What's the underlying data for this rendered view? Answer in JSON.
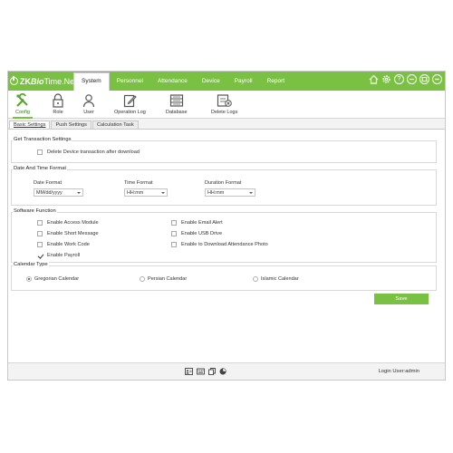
{
  "app": {
    "logo": {
      "zk": "ZK",
      "bio": "Bio",
      "rest": "Time.Net"
    },
    "nav": [
      "System",
      "Personnel",
      "Attendance",
      "Device",
      "Payroll",
      "Report"
    ],
    "active_nav": "System",
    "window_controls": [
      "home-icon",
      "gear-icon",
      "help-icon",
      "minimize-icon",
      "maximize-icon",
      "close-icon"
    ],
    "help_glyph": "?"
  },
  "toolbar": {
    "items": [
      {
        "label": "Config",
        "icon": "config-icon",
        "active": true
      },
      {
        "label": "Role",
        "icon": "lock-icon"
      },
      {
        "label": "User",
        "icon": "user-icon"
      },
      {
        "label": "Operation Log",
        "icon": "edit-log-icon"
      },
      {
        "label": "Database",
        "icon": "database-icon"
      },
      {
        "label": "Delete Logs",
        "icon": "delete-logs-icon"
      }
    ]
  },
  "subtabs": [
    "Basic Settings",
    "Push Settings",
    "Calculation Task"
  ],
  "active_subtab": "Basic Settings",
  "transaction": {
    "title": "Get Transaction Settings",
    "delete_label": "Delete Device transaction after download",
    "delete_checked": false
  },
  "datetime": {
    "title": "Date And Time Format",
    "date_label": "Date Format",
    "date_value": "MM/dd/yyyy",
    "time_label": "Time Format",
    "time_value": "HH:mm",
    "duration_label": "Duration Format",
    "duration_value": "HH:mm"
  },
  "software": {
    "title": "Software Function",
    "left": [
      {
        "label": "Enable Access Module",
        "checked": false
      },
      {
        "label": "Enable Short Message",
        "checked": false
      },
      {
        "label": "Enable Work Code",
        "checked": false
      },
      {
        "label": "Enable Payroll",
        "checked": true
      }
    ],
    "right": [
      {
        "label": "Enable Email Alert",
        "checked": false
      },
      {
        "label": "Enable USB Drive",
        "checked": false
      },
      {
        "label": "Enable to Download Attendance Photo",
        "checked": false
      }
    ]
  },
  "calendar": {
    "title": "Calendar Type",
    "options": [
      "Gregorian Calendar",
      "Persian Calendar",
      "Islamic Calendar"
    ],
    "selected": "Gregorian Calendar"
  },
  "save_label": "Save",
  "status": {
    "icons": [
      "id-card-icon",
      "keyboard-icon",
      "copy-icon",
      "pie-chart-icon"
    ],
    "login_text": "Login User:admin"
  },
  "colors": {
    "accent": "#7ac143",
    "accent_dark": "#2f7d1c",
    "panel": "#f3f3f3"
  }
}
